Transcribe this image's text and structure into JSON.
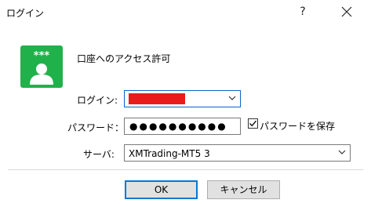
{
  "window": {
    "title": "ログイン",
    "help_label": "?",
    "icon_asterisks": "***"
  },
  "form": {
    "heading": "口座へのアクセス許可",
    "login_label": "ログイン:",
    "password_label": "パスワード：",
    "password_value": "●●●●●●●●●●",
    "save_password_label": "パスワードを保存",
    "save_password_checked": true,
    "server_label": "サーバ:",
    "server_value": "XMTrading-MT5 3"
  },
  "buttons": {
    "ok": "OK",
    "cancel": "キャンセル"
  },
  "colors": {
    "accent": "#0078d7",
    "icon_green": "#21b14b",
    "redacted": "#ea1b1b"
  }
}
